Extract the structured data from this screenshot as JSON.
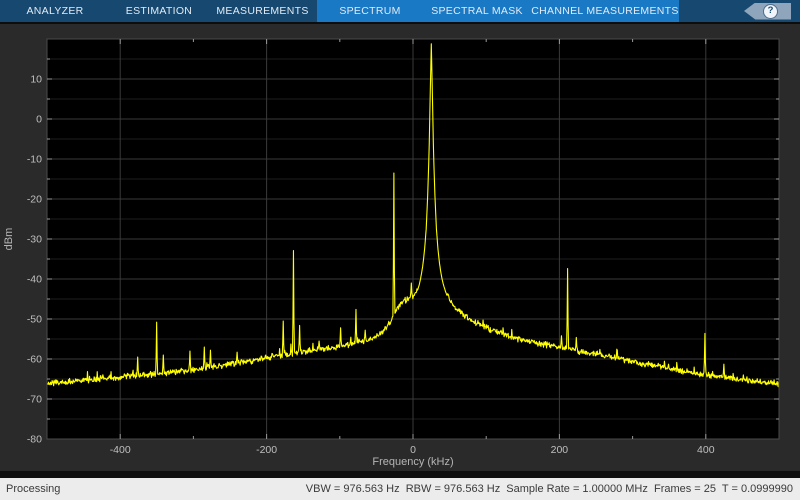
{
  "toolstrip": {
    "tabs_left": [
      {
        "label": "ANALYZER"
      },
      {
        "label": "ESTIMATION"
      },
      {
        "label": "MEASUREMENTS"
      }
    ],
    "tabs_context": [
      {
        "label": "SPECTRUM"
      },
      {
        "label": "SPECTRAL MASK"
      },
      {
        "label": "CHANNEL MEASUREMENTS"
      }
    ],
    "help_icon": "?",
    "colors": {
      "bar_dark": "#164870",
      "bar_light": "#1979c4",
      "tab_text": "#e2ebf4"
    }
  },
  "statusbar": {
    "left": "Processing",
    "right": "VBW = 976.563 Hz  RBW = 976.563 Hz  Sample Rate = 1.00000 MHz  Frames = 25  T = 0.0999990"
  },
  "chart_data": {
    "type": "line",
    "title": "",
    "xlabel": "Frequency (kHz)",
    "ylabel": "dBm",
    "xlim": [
      -500,
      500
    ],
    "ylim": [
      -80,
      20
    ],
    "xticks": [
      -400,
      -200,
      0,
      200,
      400
    ],
    "yticks": [
      10,
      0,
      -10,
      -20,
      -30,
      -40,
      -50,
      -60,
      -70,
      -80
    ],
    "grid": true,
    "legend": "none",
    "series_name": "spectrum-trace",
    "colors": {
      "plot_bg": "#000000",
      "grid_major": "#3a3a3a",
      "grid_minor": "#1e1e1e",
      "axis_border": "#4a4a4a",
      "tick": "#999999",
      "tick_label": "#bfbfbf",
      "axis_label": "#b5b5b5",
      "trace": "#ffff00"
    },
    "baseline_anchors": [
      [
        -500,
        -66.2
      ],
      [
        -470,
        -65.6
      ],
      [
        -440,
        -65.1
      ],
      [
        -410,
        -64.8
      ],
      [
        -390,
        -64.4
      ],
      [
        -360,
        -63.9
      ],
      [
        -330,
        -63.3
      ],
      [
        -300,
        -62.7
      ],
      [
        -270,
        -61.9
      ],
      [
        -240,
        -61.0
      ],
      [
        -215,
        -60.2
      ],
      [
        -200,
        -59.6
      ],
      [
        -180,
        -59.0
      ],
      [
        -160,
        -58.4
      ],
      [
        -140,
        -57.9
      ],
      [
        -120,
        -57.4
      ],
      [
        -100,
        -56.8
      ],
      [
        -85,
        -56.3
      ],
      [
        -70,
        -55.6
      ],
      [
        -60,
        -55.1
      ],
      [
        -50,
        -54.3
      ],
      [
        -45,
        -53.7
      ],
      [
        -40,
        -52.9
      ],
      [
        -35,
        -51.8
      ],
      [
        -30,
        -50.3
      ],
      [
        -27,
        -49.2
      ],
      [
        -25,
        -48.3
      ],
      [
        -22,
        -47.3
      ],
      [
        -18,
        -46.5
      ],
      [
        -14,
        -45.9
      ],
      [
        -10,
        -45.3
      ],
      [
        -5,
        -44.8
      ],
      [
        0,
        -44.4
      ],
      [
        3,
        -43.9
      ],
      [
        6,
        -42.8
      ],
      [
        8,
        -41.8
      ],
      [
        10,
        -40.3
      ],
      [
        12,
        -38.3
      ],
      [
        14,
        -35.8
      ],
      [
        16,
        -32.3
      ],
      [
        18,
        -27.5
      ],
      [
        20,
        -19.5
      ],
      [
        22,
        -8
      ],
      [
        23.5,
        6
      ],
      [
        25,
        18.8
      ],
      [
        26.5,
        6
      ],
      [
        28,
        -8
      ],
      [
        30,
        -19.5
      ],
      [
        32,
        -27.5
      ],
      [
        34,
        -32.3
      ],
      [
        36,
        -35.8
      ],
      [
        38,
        -38.3
      ],
      [
        40,
        -40.3
      ],
      [
        43,
        -42.3
      ],
      [
        46,
        -43.9
      ],
      [
        50,
        -45.2
      ],
      [
        55,
        -46.6
      ],
      [
        60,
        -47.6
      ],
      [
        70,
        -49.1
      ],
      [
        80,
        -50.3
      ],
      [
        90,
        -51.3
      ],
      [
        100,
        -52.2
      ],
      [
        115,
        -53.3
      ],
      [
        130,
        -54.2
      ],
      [
        145,
        -55.0
      ],
      [
        160,
        -55.7
      ],
      [
        180,
        -56.4
      ],
      [
        200,
        -57.1
      ],
      [
        220,
        -57.8
      ],
      [
        240,
        -58.4
      ],
      [
        260,
        -59.1
      ],
      [
        280,
        -59.8
      ],
      [
        300,
        -60.6
      ],
      [
        320,
        -61.3
      ],
      [
        340,
        -62.0
      ],
      [
        360,
        -62.7
      ],
      [
        380,
        -63.3
      ],
      [
        400,
        -63.9
      ],
      [
        420,
        -64.4
      ],
      [
        440,
        -64.9
      ],
      [
        460,
        -65.4
      ],
      [
        480,
        -65.8
      ],
      [
        500,
        -66.3
      ]
    ],
    "spikes": [
      [
        -376,
        -59.5
      ],
      [
        -350,
        -50.8
      ],
      [
        -341,
        -59.0
      ],
      [
        -305,
        -58.0
      ],
      [
        -285,
        -57.0
      ],
      [
        -277,
        -57.8
      ],
      [
        -240,
        -58.3
      ],
      [
        -177,
        -50.5
      ],
      [
        -163,
        -32.9
      ],
      [
        -155,
        -51.6
      ],
      [
        -128,
        -55.5
      ],
      [
        -99,
        -52.2
      ],
      [
        -78,
        -47.6
      ],
      [
        -65,
        -52.8
      ],
      [
        -26,
        -13.5
      ],
      [
        -2,
        -41.0
      ],
      [
        25,
        18.8
      ],
      [
        203,
        -54.2
      ],
      [
        211,
        -37.4
      ],
      [
        223,
        -54.6
      ],
      [
        255,
        -57.6
      ],
      [
        279,
        -57.8
      ],
      [
        399,
        -53.6
      ],
      [
        425,
        -61.3
      ]
    ]
  }
}
